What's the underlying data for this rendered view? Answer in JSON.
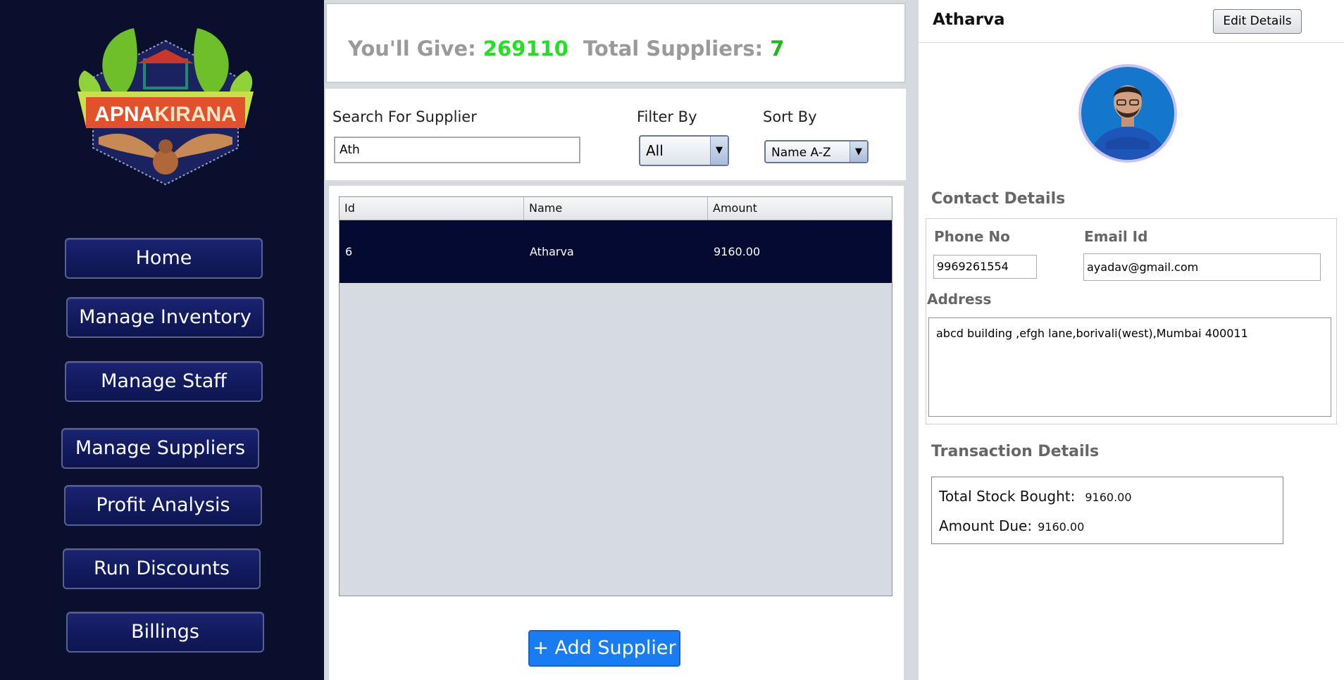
{
  "sidebar": {
    "logo_text_apna": "APNA",
    "logo_text_kirana": "KIRANA",
    "nav": [
      {
        "label": "Home"
      },
      {
        "label": "Manage Inventory"
      },
      {
        "label": "Manage Staff"
      },
      {
        "label": "Manage Suppliers"
      },
      {
        "label": "Profit Analysis"
      },
      {
        "label": "Run Discounts"
      },
      {
        "label": "Billings"
      }
    ]
  },
  "summary": {
    "give_label": "You'll Give:",
    "give_value": "269110",
    "suppliers_label": "Total Suppliers:",
    "suppliers_value": "7"
  },
  "search": {
    "label": "Search For Supplier",
    "value": "Ath",
    "filter_label": "Filter By",
    "filter_value": "All",
    "sort_label": "Sort By",
    "sort_value": "Name A-Z"
  },
  "table": {
    "columns": [
      "Id",
      "Name",
      "Amount"
    ],
    "rows": [
      {
        "id": "6",
        "name": "Atharva",
        "amount": "9160.00"
      }
    ]
  },
  "add_button": "+ Add Supplier",
  "detail": {
    "name": "Atharva",
    "edit_label": "Edit Details",
    "contact_title": "Contact Details",
    "phone_label": "Phone No",
    "phone_value": "9969261554",
    "email_label": "Email Id",
    "email_value": "ayadav@gmail.com",
    "address_label": "Address",
    "address_value": "abcd building ,efgh lane,borivali(west),Mumbai 400011",
    "transaction_title": "Transaction Details",
    "stock_label": "Total Stock Bought:",
    "stock_value": "9160.00",
    "due_label": "Amount Due:",
    "due_value": "9160.00"
  },
  "colors": {
    "sidebar_bg": "#0a0f2e",
    "accent_green": "#22e022",
    "selected_row": "#050a32",
    "add_button": "#1a7cf2"
  }
}
